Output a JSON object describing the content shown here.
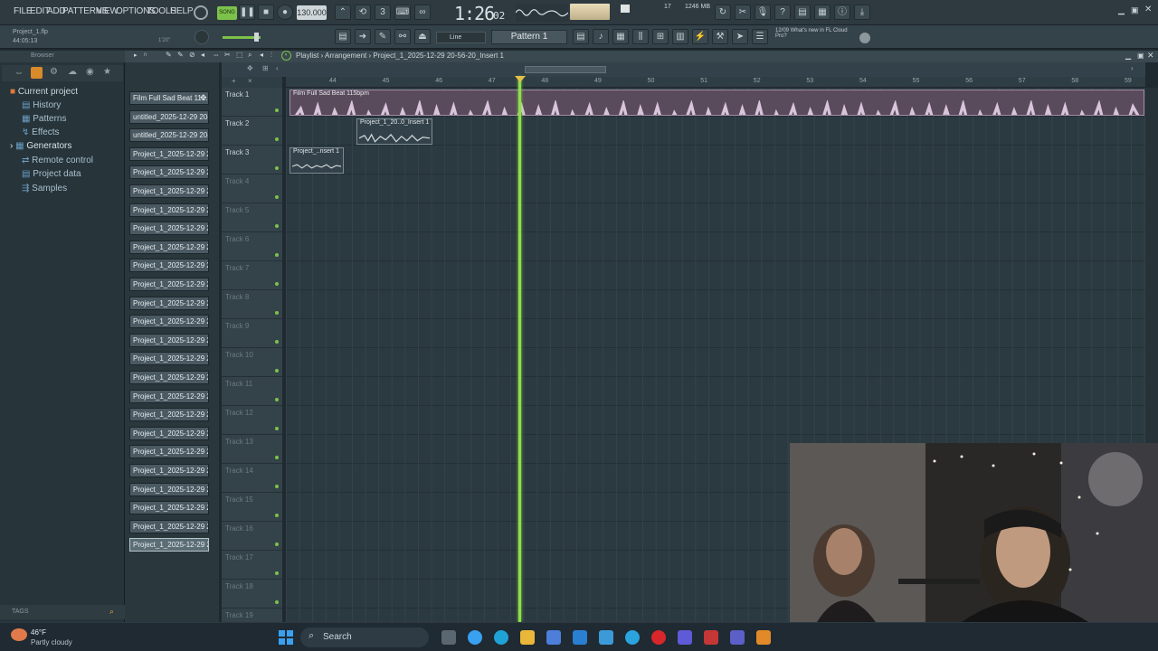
{
  "menu": {
    "file": "FILE",
    "edit": "EDIT",
    "add": "ADD",
    "patterns": "PATTERNS",
    "view": "VIEW",
    "options": "OPTIONS",
    "tools": "TOOLS",
    "help": "HELP"
  },
  "transport": {
    "song_mode": "SONG",
    "tempo": "130.000",
    "time": "1:26",
    "time_ticks": "02",
    "cpu": "17",
    "ram": "1246 MB"
  },
  "project": {
    "file": "Project_1.flp",
    "elapsed": "44:05:13",
    "hint": "1'20\""
  },
  "toolbar2": {
    "snap": "Line",
    "pattern": "Pattern 1",
    "news_date": "12/09",
    "news_text": "What's new in FL Cloud Pro?"
  },
  "playlist": {
    "title": "Playlist",
    "sep": "›",
    "view": "Arrangement",
    "clip": "Project_1_2025-12-29 20-56-20_Insert 1"
  },
  "browser": {
    "title": "Browser",
    "items": [
      "Current project",
      "History",
      "Patterns",
      "Effects",
      "Generators",
      "Remote control",
      "Project data",
      "Samples"
    ],
    "tags": "TAGS"
  },
  "channels": [
    "Film Full Sad Beat 11...",
    "untitled_2025-12-29 20-...",
    "untitled_2025-12-29 20-...",
    "Project_1_2025-12-29 2...",
    "Project_1_2025-12-29 2...",
    "Project_1_2025-12-29 2...",
    "Project_1_2025-12-29 2...",
    "Project_1_2025-12-29 2...",
    "Project_1_2025-12-29 2...",
    "Project_1_2025-12-29 2...",
    "Project_1_2025-12-29 2...",
    "Project_1_2025-12-29 2...",
    "Project_1_2025-12-29 2...",
    "Project_1_2025-12-29 2...",
    "Project_1_2025-12-29 2...",
    "Project_1_2025-12-29 2...",
    "Project_1_2025-12-29 2...",
    "Project_1_2025-12-29 2...",
    "Project_1_2025-12-29 2...",
    "Project_1_2025-12-29 2...",
    "Project_1_2025-12-29 2...",
    "Project_1_2025-12-29 2...",
    "Project_1_2025-12-29 2...",
    "Project_1_2025-12-29 2...",
    "Project_1_2025-12-29 2..."
  ],
  "tracks": [
    "Track 1",
    "Track 2",
    "Track 3",
    "Track 4",
    "Track 5",
    "Track 6",
    "Track 7",
    "Track 8",
    "Track 9",
    "Track 10",
    "Track 11",
    "Track 12",
    "Track 13",
    "Track 14",
    "Track 15",
    "Track 16",
    "Track 17",
    "Track 18",
    "Track 19"
  ],
  "ruler": [
    "44",
    "45",
    "46",
    "47",
    "48",
    "49",
    "50",
    "51",
    "52",
    "53",
    "54",
    "55",
    "56",
    "57",
    "58",
    "59"
  ],
  "clips": {
    "track1": "Film Full Sad Beat 115bpm",
    "track2": "Project_1_20..0_Insert 1",
    "track3": "Project_..nsert 1"
  },
  "taskbar": {
    "temp": "46°F",
    "weather": "Partly cloudy",
    "search": "Search"
  },
  "colors": {
    "playhead": "#8de04a",
    "accent": "#7cc24a"
  }
}
